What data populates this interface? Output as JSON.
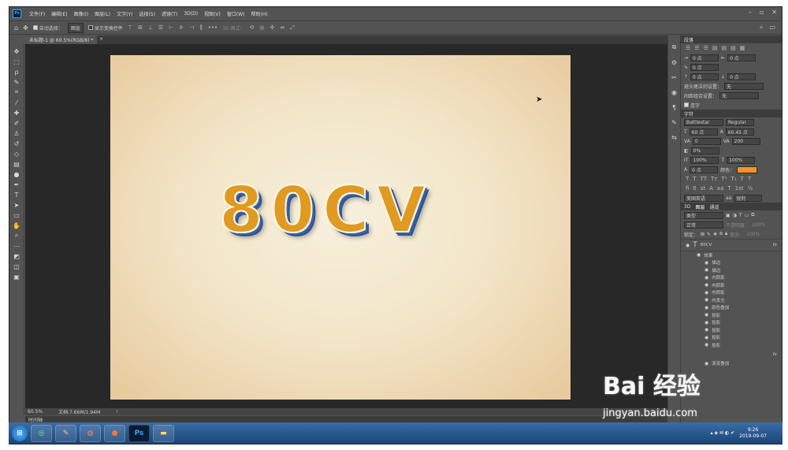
{
  "app": {
    "logo": "Ps",
    "menu": [
      "文件(F)",
      "编辑(E)",
      "图像(I)",
      "图层(L)",
      "文字(Y)",
      "选择(S)",
      "滤镜(T)",
      "3D(D)",
      "视图(V)",
      "窗口(W)",
      "帮助(H)"
    ],
    "win_controls": [
      "–",
      "▫",
      "✕"
    ]
  },
  "options": {
    "auto_select_label": "自动选择：",
    "layer_select": "图层",
    "show_transform_label": "显示变换控件",
    "mode_label": "3D 模式："
  },
  "document": {
    "tab_title": "未标题-1 @ 60.5%(RGB/8) *",
    "text": "80CV"
  },
  "status": {
    "zoom": "60.5%",
    "doc_info": "文档:7.66M/1.94M"
  },
  "timeline": {
    "label": "时间轴"
  },
  "paragraph_panel": {
    "title": "段落",
    "left_indent": "0 点",
    "right_indent": "0 点",
    "first_indent": "0 点",
    "space_before": "0 点",
    "space_after": "0 点",
    "kinsoku_label": "避头尾法则设置：",
    "kinsoku_value": "无",
    "mojikumi_label": "间距组合设置：",
    "mojikumi_value": "无",
    "hyphenate_label": "连字"
  },
  "character_panel": {
    "title": "字符",
    "font_family": "Battlestar",
    "font_style": "Regular",
    "font_size": "60 点",
    "leading": "60.45 点",
    "kerning": "0",
    "tracking": "200",
    "vertical_scale": "100%",
    "horizontal_scale": "100%",
    "baseline": "0 点",
    "color_label": "颜色：",
    "color": "#f7931e",
    "tsume": "0%",
    "language": "美国英语",
    "aa": "锐利",
    "aa_label": "aa"
  },
  "layers_panel": {
    "tabs": [
      "3D",
      "图层",
      "通道"
    ],
    "filter_kind": "类型",
    "blend_mode": "正常",
    "opacity_label": "不透明度：",
    "opacity": "100%",
    "lock_label": "锁定：",
    "fill_label": "填充：",
    "fill": "100%",
    "layer_name": "80CV",
    "fx_label": "fx",
    "effects_label": "效果",
    "effects": [
      "描边",
      "描边",
      "内阴影",
      "内阴影",
      "内阴影",
      "内发光",
      "颜色叠加",
      "投影",
      "投影",
      "投影",
      "投影",
      "投影"
    ],
    "bottom_effect": "渐变叠加"
  },
  "taskbar": {
    "time": "9:26",
    "date": "2019-09-07"
  },
  "watermark": {
    "text": "Bai 经验",
    "url": "jingyan.baidu.com"
  }
}
